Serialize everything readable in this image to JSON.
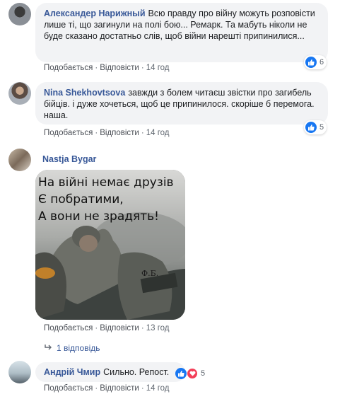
{
  "common": {
    "like_label": "Подобається",
    "reply_label": "Відповісти",
    "dot": "·"
  },
  "comments": [
    {
      "author": "Александер Нарижный",
      "text": "Всю правду про війну можуть розповісти лише ті, що загинули на полі бою... Ремарк. Та мабуть ніколи не буде сказано достатньо слів, щоб війни нарешті припинилися...",
      "time": "14 год",
      "reactions": "6"
    },
    {
      "author": "Nina Shekhovtsova",
      "text": "завжди з болем читаєш звістки про загибель бійців. і дуже хочеться, щоб це припинилося. скоріше б перемога. наша.",
      "time": "14 год",
      "reactions": "5"
    },
    {
      "author": "Nastja Bygar",
      "image_text": [
        "На війні немає друзів",
        "Є побратими,",
        "А вони не зрадять!"
      ],
      "image_signature": "Ф.Б.",
      "time": "13 год",
      "replies_label": "1 відповідь"
    },
    {
      "author": "Андрій Чмир",
      "text": "Сильно. Репост.",
      "time": "14 год",
      "reactions": "5"
    }
  ],
  "colors": {
    "link": "#385898",
    "bubble": "#f2f3f5",
    "like": "#1877f2",
    "love": "#f33e58"
  }
}
